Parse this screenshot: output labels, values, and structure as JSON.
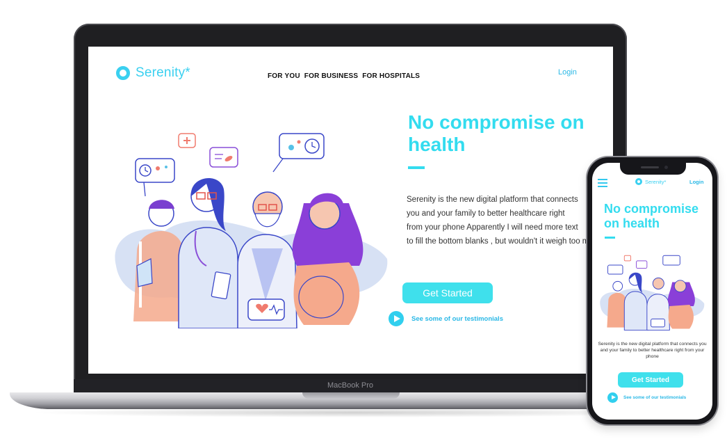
{
  "brand": {
    "name": "Serenity*",
    "accent": "#33dcef",
    "link_color": "#2ab8e6"
  },
  "desktop": {
    "nav": [
      {
        "label": "FOR YOU"
      },
      {
        "label": "FOR BUSINESS"
      },
      {
        "label": "FOR HOSPITALS"
      }
    ],
    "login": "Login",
    "hero": {
      "title": "No compromise on health",
      "description": "Serenity is the new digital platform that connects\nyou and your family to better healthcare right\nfrom your phone  Apparently I will need more text\nto fill the bottom blanks , but wouldn't it weigh too my",
      "cta": "Get Started",
      "testimonials": "See some of our testimonials"
    }
  },
  "device": {
    "laptop_label": "MacBook Pro"
  },
  "mobile": {
    "logo": "Serenity*",
    "login": "Login",
    "title": "No compromise on health",
    "description": "Serenity is the new digital platform that connects you and your family to better healthcare right from your phone",
    "cta": "Get Started",
    "testimonials": "See some of our testimonials"
  },
  "icons": [
    "menu-icon",
    "play-icon",
    "logo-ring-icon",
    "heart-monitor-icon",
    "medical-cross-icon",
    "clock-icon",
    "pill-icon"
  ]
}
